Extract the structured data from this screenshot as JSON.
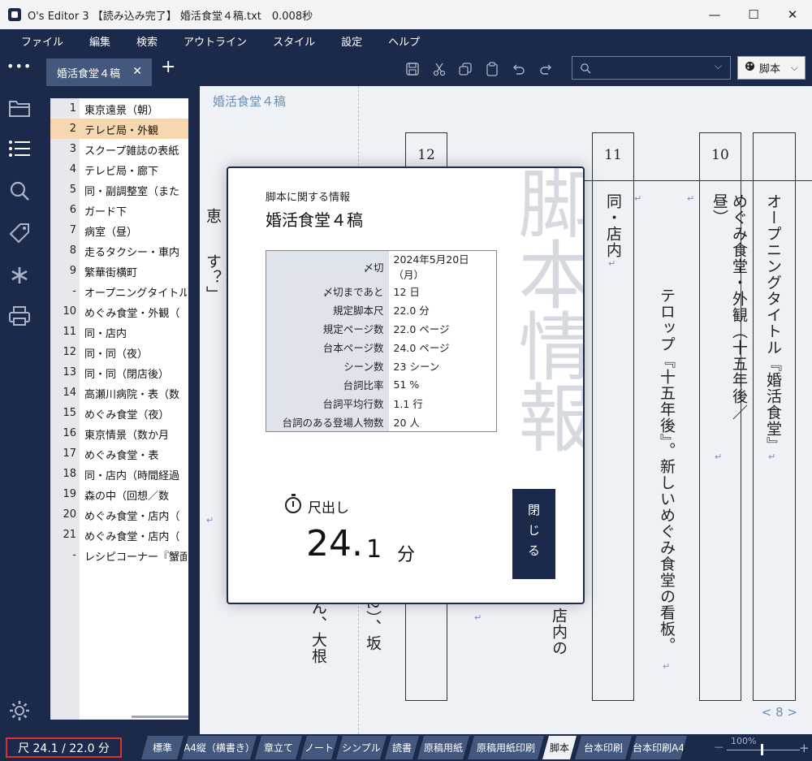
{
  "window": {
    "title": "O's Editor 3 【読み込み完了】 婚活食堂４稿.txt　0.008秒",
    "controls": [
      "—",
      "☐",
      "✕"
    ]
  },
  "menu": [
    "ファイル",
    "編集",
    "検索",
    "アウトライン",
    "スタイル",
    "設定",
    "ヘルプ"
  ],
  "tabs": {
    "more": "•••",
    "active_tab": "婚活食堂４稿",
    "close": "✕",
    "add": "+"
  },
  "search": {
    "placeholder": ""
  },
  "mode": {
    "label": "脚本",
    "icon": "palette-icon"
  },
  "outline": [
    {
      "num": "1",
      "title": "東京遠景（朝）"
    },
    {
      "num": "2",
      "title": "テレビ局・外観"
    },
    {
      "num": "3",
      "title": "スクープ雑誌の表紙"
    },
    {
      "num": "4",
      "title": "テレビ局・廊下"
    },
    {
      "num": "5",
      "title": "同・副調整室（また"
    },
    {
      "num": "6",
      "title": "ガード下"
    },
    {
      "num": "7",
      "title": "病室（昼）"
    },
    {
      "num": "8",
      "title": "走るタクシー・車内（"
    },
    {
      "num": "9",
      "title": "繁華街横町"
    },
    {
      "num": "-",
      "title": "オープニングタイトル『"
    },
    {
      "num": "10",
      "title": "めぐみ食堂・外観（"
    },
    {
      "num": "11",
      "title": "同・店内"
    },
    {
      "num": "12",
      "title": "同・同（夜）"
    },
    {
      "num": "13",
      "title": "同・同（閉店後）"
    },
    {
      "num": "14",
      "title": "高瀬川病院・表（数"
    },
    {
      "num": "15",
      "title": "めぐみ食堂（夜）"
    },
    {
      "num": "16",
      "title": "東京情景（数か月"
    },
    {
      "num": "17",
      "title": "めぐみ食堂・表"
    },
    {
      "num": "18",
      "title": "同・店内（時間経過"
    },
    {
      "num": "19",
      "title": "森の中（回想／数"
    },
    {
      "num": "20",
      "title": "めぐみ食堂・店内（"
    },
    {
      "num": "21",
      "title": "めぐみ食堂・店内（"
    },
    {
      "num": "-",
      "title": "レシピコーナー『蟹面』"
    }
  ],
  "outline_selected_index": 1,
  "editor": {
    "doc_title": "婚活食堂４稿",
    "scene_numbers": [
      "12",
      "11",
      "10"
    ],
    "col_name": "恵",
    "col_dialog": "「坂口さんはおでん、どうします？」",
    "col_fragment_a": "ん、大根",
    "col_fragment_b": "2）、坂",
    "col_11": "同・店内",
    "col_11_bottom": "店内の",
    "col_telop": "テロップ『十五年後』。新しいめぐみ食堂の看板。",
    "col_10": "めぐみ食堂・外観（十五年後／昼）",
    "col_opening": "オープニングタイトル『婚活食堂』",
    "return_mark": "↵",
    "pager": "< 8 >"
  },
  "modal": {
    "bg_text": "脚本情報",
    "caption": "脚本に関する情報",
    "title": "婚活食堂４稿",
    "rows": [
      {
        "k": "〆切",
        "v": "2024年5月20日（月）"
      },
      {
        "k": "〆切まであと",
        "v": "12 日"
      },
      {
        "k": "規定脚本尺",
        "v": "22.0 分"
      },
      {
        "k": "規定ページ数",
        "v": "22.0 ページ"
      },
      {
        "k": "台本ページ数",
        "v": "24.0 ページ"
      },
      {
        "k": "シーン数",
        "v": "23 シーン"
      },
      {
        "k": "台詞比率",
        "v": "51 %"
      },
      {
        "k": "台詞平均行数",
        "v": "1.1 行"
      },
      {
        "k": "台詞のある登場人物数",
        "v": "20 人"
      }
    ],
    "timer_label": "尺出し",
    "timer_int": "24.",
    "timer_dec": "1",
    "timer_unit": "分",
    "close_label": "閉じる"
  },
  "status": {
    "ruler": "尺 24.1 / 22.0 分",
    "tabs": [
      "標準",
      "A4縦（横書き）",
      "章立て",
      "ノート",
      "シンプル",
      "読書",
      "原稿用紙",
      "原稿用紙印刷",
      "脚本",
      "台本印刷",
      "台本印刷A4"
    ],
    "active_tab": "脚本",
    "zoom": "100%",
    "zoom_minus": "—",
    "zoom_plus": "+"
  },
  "colors": {
    "navy": "#1b2a4a",
    "tab": "#44577d",
    "selected_row": "#f6d7b0",
    "accent_text": "#6a8fb0",
    "status_alert": "#d8342c"
  }
}
